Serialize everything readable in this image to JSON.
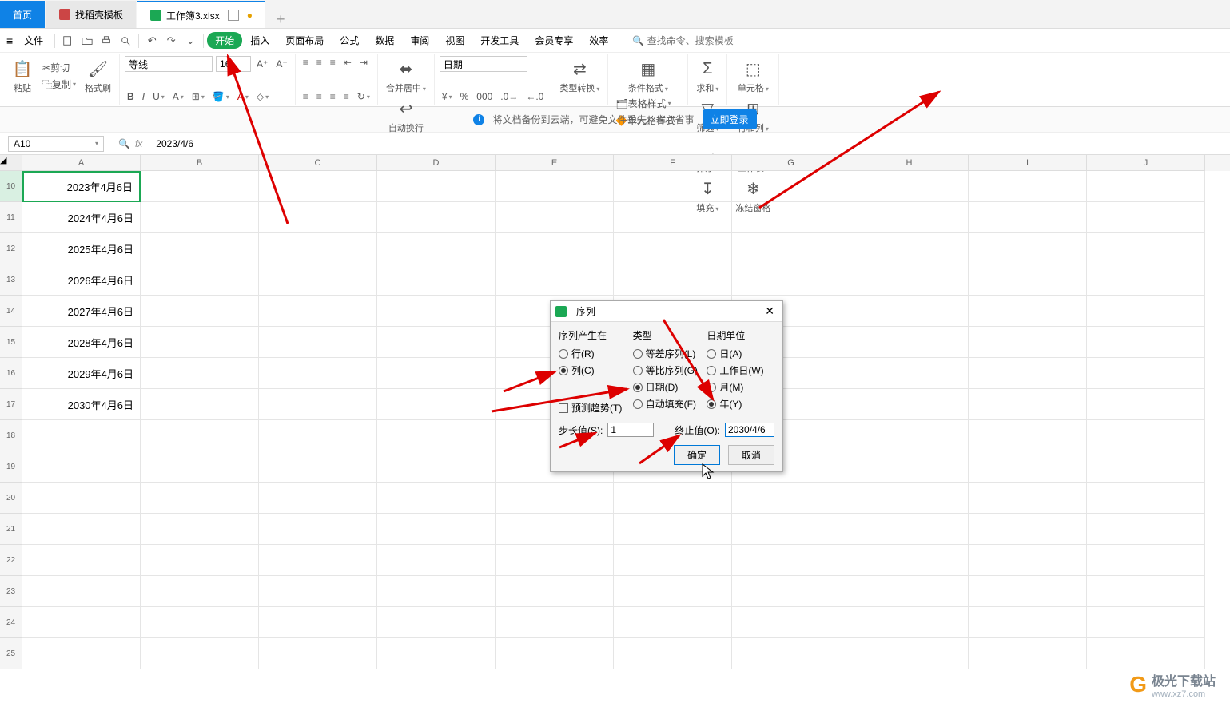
{
  "tabs": {
    "home": "首页",
    "template": "找稻壳模板",
    "file": "工作簿3.xlsx"
  },
  "menu": {
    "file": "文件",
    "start": "开始",
    "insert": "插入",
    "pagelayout": "页面布局",
    "formula": "公式",
    "data": "数据",
    "review": "审阅",
    "view": "视图",
    "devtools": "开发工具",
    "vip": "会员专享",
    "efficiency": "效率",
    "search_ph": "查找命令、搜索模板"
  },
  "ribbon": {
    "paste": "粘贴",
    "cut": "剪切",
    "copy": "复制",
    "format_painter": "格式刷",
    "font_name": "等线",
    "font_size": "16",
    "merge_center": "合并居中",
    "wrap": "自动换行",
    "numfmt": "日期",
    "type_convert": "类型转换",
    "cond_fmt": "条件格式",
    "table_style": "表格样式",
    "cell_style": "单元格样式",
    "sum": "求和",
    "filter": "筛选",
    "sort": "排序",
    "fill": "填充",
    "cells": "单元格",
    "rowscols": "行和列",
    "worksheet": "工作表",
    "freeze": "冻结窗格"
  },
  "banner": {
    "text": "将文档备份到云端，可避免文件丢失，省心省事",
    "btn": "立即登录"
  },
  "namebox": "A10",
  "formula": "2023/4/6",
  "cols": [
    "A",
    "B",
    "C",
    "D",
    "E",
    "F",
    "G",
    "H",
    "I",
    "J"
  ],
  "rows": [
    {
      "n": 10,
      "a": "2023年4月6日"
    },
    {
      "n": 11,
      "a": "2024年4月6日"
    },
    {
      "n": 12,
      "a": "2025年4月6日"
    },
    {
      "n": 13,
      "a": "2026年4月6日"
    },
    {
      "n": 14,
      "a": "2027年4月6日"
    },
    {
      "n": 15,
      "a": "2028年4月6日"
    },
    {
      "n": 16,
      "a": "2029年4月6日"
    },
    {
      "n": 17,
      "a": "2030年4月6日"
    },
    {
      "n": 18,
      "a": ""
    },
    {
      "n": 19,
      "a": ""
    },
    {
      "n": 20,
      "a": ""
    },
    {
      "n": 21,
      "a": ""
    },
    {
      "n": 22,
      "a": ""
    },
    {
      "n": 23,
      "a": ""
    },
    {
      "n": 24,
      "a": ""
    },
    {
      "n": 25,
      "a": ""
    }
  ],
  "dialog": {
    "title": "序列",
    "col1_title": "序列产生在",
    "row_opt": "行(R)",
    "col_opt": "列(C)",
    "col2_title": "类型",
    "arith": "等差序列(L)",
    "geom": "等比序列(G)",
    "date": "日期(D)",
    "autofill": "自动填充(F)",
    "col3_title": "日期单位",
    "day": "日(A)",
    "workday": "工作日(W)",
    "month": "月(M)",
    "year": "年(Y)",
    "trend": "预测趋势(T)",
    "step_label": "步长值(S):",
    "step_val": "1",
    "stop_label": "终止值(O):",
    "stop_val": "2030/4/6",
    "ok": "确定",
    "cancel": "取消"
  },
  "watermark": {
    "name": "极光下载站",
    "url": "www.xz7.com"
  }
}
